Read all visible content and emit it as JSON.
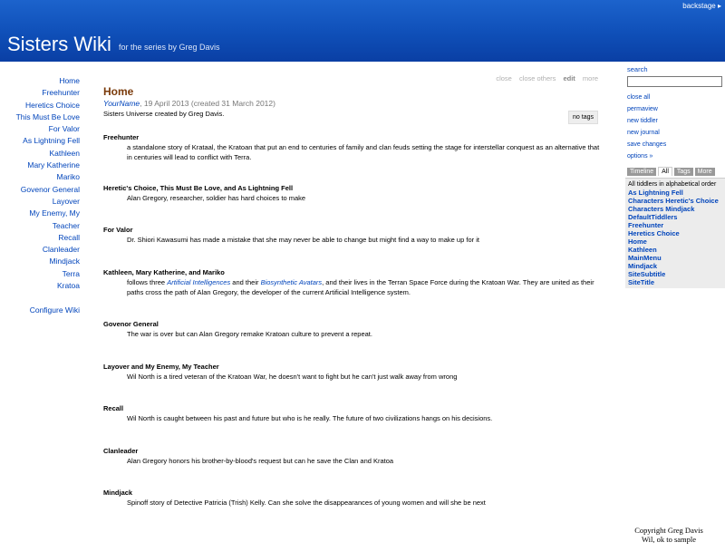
{
  "backstage": "backstage ▸",
  "site": {
    "title": "Sisters Wiki",
    "subtitle": "for the series by Greg Davis"
  },
  "mainmenu": {
    "items": [
      "Home",
      "Freehunter",
      "Heretics Choice",
      "This Must Be Love",
      "For Valor",
      "As Lightning Fell",
      "Kathleen",
      "Mary Katherine",
      "Mariko",
      "Govenor General",
      "Layover",
      "My Enemy, My",
      "Teacher",
      "Recall",
      "Clanleader",
      "Mindjack",
      "Terra",
      "Kratoa"
    ],
    "configure": "Configure Wiki"
  },
  "toolbar": [
    "close",
    "close others",
    "edit",
    "more"
  ],
  "tiddler": {
    "title": "Home",
    "modifier": "YourName",
    "subtitle_rest": ", 19 April 2013 (created 31 March 2012)",
    "tags": "no tags",
    "intro": "Sisters Universe created by Greg Davis.",
    "entries": [
      {
        "heading": "Freehunter",
        "text": "a standalone story of Krataal, the Kratoan that put an end to centuries of family and clan feuds setting the stage for interstellar conquest as an alternative that in centuries will lead to conflict with Terra."
      },
      {
        "heading": "Heretic's Choice, This Must Be Love, and As Lightning Fell",
        "text": "Alan Gregory, researcher, soldier has hard choices to make"
      },
      {
        "heading": "For Valor",
        "text": "Dr. Shiori Kawasumi has made a mistake that she may never be able to change but might find a way to make up for it"
      },
      {
        "heading": "Kathleen, Mary Katherine, and Mariko",
        "text_a": "follows three ",
        "link_a": "Artificial Intelligences",
        "text_b": " and their ",
        "link_b": "Biosynthetic Avatars",
        "text_c": ", and their lives in the Terran Space Force during the Kratoan War. They are united as their paths cross the path of Alan Gregory, the developer of the current Artificial Intelligence system."
      },
      {
        "heading": "Govenor General",
        "text": "The war is over but can Alan Gregory remake Kratoan culture to prevent a repeat."
      },
      {
        "heading": "Layover and My Enemy, My Teacher",
        "text": "Wil North is a tired veteran of the Kratoan War, he doesn't want to fight but he can't just walk away from wrong"
      },
      {
        "heading": "Recall",
        "text": "Wil North is caught between his past and future but who is he really. The future of two civilizations hangs on his decisions."
      },
      {
        "heading": "Clanleader",
        "text": "Alan Gregory honors his brother-by-blood's request but can he save the Clan and Kratoa"
      },
      {
        "heading": "Mindjack",
        "text": "Spinoff story of Detective Patricia (Trish) Kelly. Can she solve the disappearances of young women and will she be next"
      }
    ]
  },
  "sidebar": {
    "search_label": "search",
    "search_value": "",
    "options": [
      "close all",
      "permaview",
      "new tiddler",
      "new journal",
      "save changes",
      "options »"
    ],
    "tabs": [
      "Timeline",
      "All",
      "Tags",
      "More"
    ],
    "list_heading": "All tiddlers in alphabetical order",
    "list": [
      "As Lightning Fell",
      "Characters Heretic's Choice",
      "Characters Mindjack",
      "DefaultTiddlers",
      "Freehunter",
      "Heretics Choice",
      "Home",
      "Kathleen",
      "MainMenu",
      "Mindjack",
      "SiteSubtitle",
      "SiteTitle"
    ]
  },
  "copyright": {
    "line1": "Copyright Greg Davis",
    "line2": "Wil, ok to sample"
  }
}
